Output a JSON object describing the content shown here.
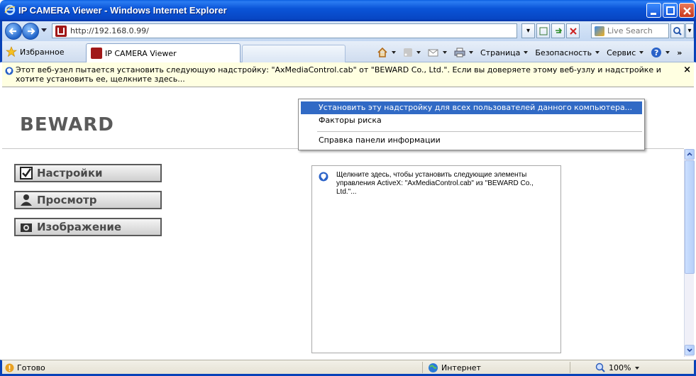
{
  "window": {
    "title": "IP CAMERA Viewer - Windows Internet Explorer"
  },
  "address_bar": {
    "url": "http://192.168.0.99/"
  },
  "search": {
    "placeholder": "Live Search"
  },
  "favorites": {
    "label": "Избранное"
  },
  "tab": {
    "title": "IP CAMERA Viewer"
  },
  "command_bar": {
    "page": "Страница",
    "security": "Безопасность",
    "tools": "Сервис"
  },
  "info_bar": {
    "message": "Этот веб-узел пытается установить следующую надстройку: \"AxMediaControl.cab\" от \"BEWARD Co., Ltd.\". Если вы доверяете этому веб-узлу и надстройке и хотите установить ее, щелкните здесь...",
    "close": "×"
  },
  "context_menu": {
    "items": [
      "Установить эту надстройку для всех пользователей данного компьютера...",
      "Факторы риска",
      "Справка панели информации"
    ]
  },
  "page": {
    "logo": "BEWARD",
    "nav": [
      {
        "label": "Настройки",
        "icon": "checkbox-icon"
      },
      {
        "label": "Просмотр",
        "icon": "person-icon"
      },
      {
        "label": "Изображение",
        "icon": "camera-icon"
      }
    ],
    "activex_message": "Щелкните здесь, чтобы установить следующие элементы управления ActiveX: \"AxMediaControl.cab\" из \"BEWARD Co., Ltd.\"..."
  },
  "status_bar": {
    "ready": "Готово",
    "zone": "Интернет",
    "zoom": "100%"
  },
  "colors": {
    "title_bar": "#0a55d8",
    "info_bar": "#ffffe1",
    "menu_highlight": "#316ac5"
  }
}
